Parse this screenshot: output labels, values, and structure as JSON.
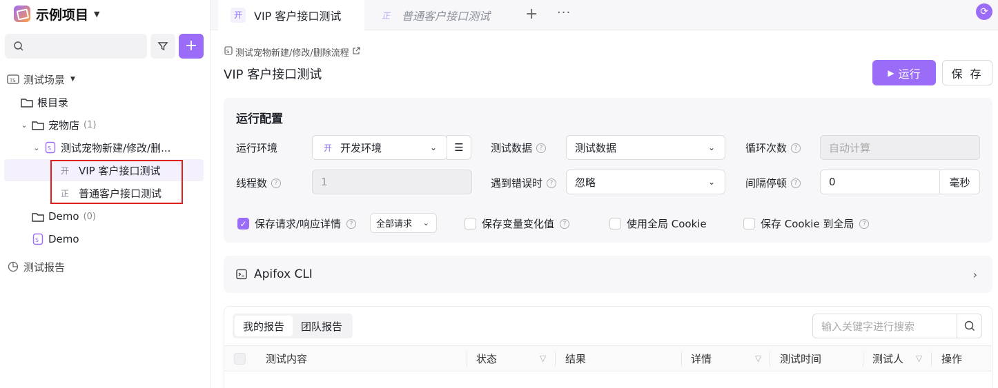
{
  "project": {
    "name": "示例项目"
  },
  "sidebar": {
    "scene_header": "测试场景",
    "items": [
      {
        "label": "根目录"
      },
      {
        "label": "宠物店",
        "count": "(1)"
      },
      {
        "label": "测试宠物新建/修改/删..."
      },
      {
        "tag": "开",
        "label": "VIP 客户接口测试"
      },
      {
        "tag": "正",
        "label": "普通客户接口测试"
      },
      {
        "label": "Demo",
        "count": "(0)"
      },
      {
        "label": "Demo"
      }
    ],
    "reports": "测试报告"
  },
  "tabs": [
    {
      "tag": "开",
      "label": "VIP 客户接口测试"
    },
    {
      "tag": "正",
      "label": "普通客户接口测试"
    }
  ],
  "main": {
    "breadcrumb": "测试宠物新建/修改/删除流程",
    "title": "VIP 客户接口测试",
    "run": "运行",
    "save": "保 存"
  },
  "config": {
    "title": "运行配置",
    "env_label": "运行环境",
    "env_tag": "开",
    "env_value": "开发环境",
    "data_label": "测试数据",
    "data_value": "测试数据",
    "loop_label": "循环次数",
    "loop_placeholder": "自动计算",
    "threads_label": "线程数",
    "threads_value": "1",
    "error_label": "遇到错误时",
    "error_value": "忽略",
    "interval_label": "间隔停顿",
    "interval_value": "0",
    "interval_unit": "毫秒",
    "save_detail": "保存请求/响应详情",
    "save_detail_scope": "全部请求",
    "save_vars": "保存变量变化值",
    "use_cookie": "使用全局 Cookie",
    "save_cookie": "保存 Cookie 到全局"
  },
  "cli": {
    "title": "Apifox CLI"
  },
  "reports": {
    "tab_mine": "我的报告",
    "tab_team": "团队报告",
    "search_placeholder": "输入关键字进行搜索",
    "columns": [
      "测试内容",
      "状态",
      "结果",
      "详情",
      "测试时间",
      "测试人",
      "操作"
    ]
  },
  "colors": {
    "accent": "#9b6cf7",
    "highlight_border": "#e02020"
  }
}
